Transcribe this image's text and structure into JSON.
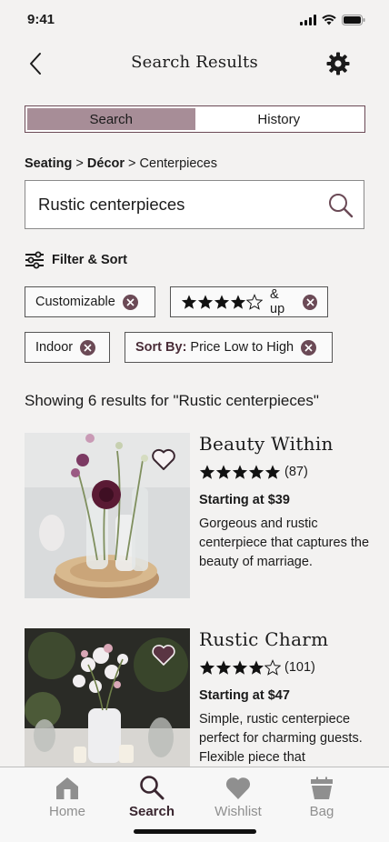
{
  "status": {
    "time": "9:41"
  },
  "header": {
    "title": "Search Results"
  },
  "segments": [
    {
      "label": "Search",
      "active": true
    },
    {
      "label": "History",
      "active": false
    }
  ],
  "breadcrumb": {
    "level1": "Seating",
    "sep1": " > ",
    "level2": "Décor",
    "sep2": " > ",
    "level3": "Centerpieces"
  },
  "search": {
    "value": "Rustic centerpieces",
    "placeholder": ""
  },
  "filter_sort": {
    "label": "Filter & Sort"
  },
  "chips": {
    "customizable": "Customizable",
    "rating_suffix": "& up",
    "rating_stars": 4,
    "indoor": "Indoor",
    "sort_label": "Sort By:",
    "sort_value": " Price Low to High"
  },
  "results_summary": "Showing 6 results for \"Rustic centerpieces\"",
  "products": [
    {
      "title": "Beauty Within",
      "rating": 5,
      "reviews": "(87)",
      "price": "Starting at $39",
      "description": "Gorgeous and rustic centerpiece that captures the beauty of marriage.",
      "favorited": false
    },
    {
      "title": "Rustic Charm",
      "rating": 4,
      "reviews": "(101)",
      "price": "Starting at $47",
      "description": "Simple, rustic centerpiece perfect for charming guests. Flexible piece that",
      "favorited": true
    }
  ],
  "nav": [
    {
      "label": "Home",
      "icon": "home-icon",
      "active": false
    },
    {
      "label": "Search",
      "icon": "search-icon",
      "active": true
    },
    {
      "label": "Wishlist",
      "icon": "heart-icon",
      "active": false
    },
    {
      "label": "Bag",
      "icon": "bag-icon",
      "active": false
    }
  ],
  "colors": {
    "accent": "#6b4a56",
    "segment_active": "#a78d97",
    "nav_active": "#3a2630",
    "nav_inactive": "#8f8f8f"
  }
}
